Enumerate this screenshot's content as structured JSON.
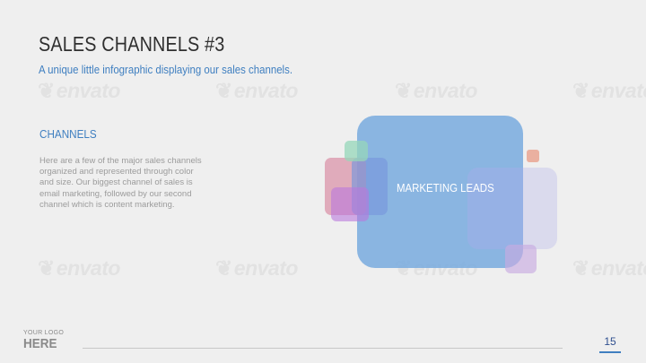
{
  "slide": {
    "title": "SALES CHANNELS #3",
    "subtitle": "A unique little infographic displaying our sales channels.",
    "section_heading": "CHANNELS",
    "body": "Here are a few of the major sales channels organized and represented through color and size. Our biggest channel of sales is email marketing, followed by our second channel which is content marketing.",
    "shape_label": "MARKETING LEADS"
  },
  "watermark": {
    "text": "envato",
    "icon": "envato-leaf-icon"
  },
  "footer": {
    "logo_small": "YOUR LOGO",
    "logo_big": "HERE",
    "page_number": "15"
  },
  "colors": {
    "accent": "#3f7fc0",
    "background": "#efefef",
    "title": "#2f2f2f",
    "body_text": "#9b9b9b",
    "big_square": "#78aade",
    "pink_square": "#db94aa",
    "green_square": "#96d7b9",
    "purple_square": "#b978dc",
    "lavender_square": "#c8c8eb",
    "orange_square": "#e8a08c"
  }
}
